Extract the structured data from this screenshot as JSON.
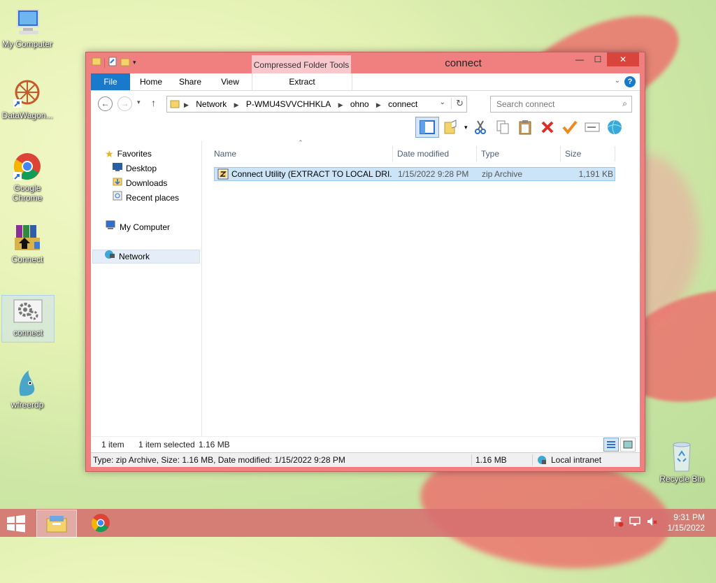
{
  "desktop": {
    "icons": [
      {
        "label": "My Computer"
      },
      {
        "label": "DataWagon..."
      },
      {
        "label": "Google Chrome"
      },
      {
        "label": "Connect"
      },
      {
        "label": "connect"
      },
      {
        "label": "wfreerdp"
      }
    ],
    "recycle_bin": "Recycle Bin"
  },
  "window": {
    "title": "connect",
    "context_tab": "Compressed Folder Tools",
    "ribbon_tabs": [
      "File",
      "Home",
      "Share",
      "View",
      "Extract"
    ],
    "breadcrumb": [
      "Network",
      "P-WMU4SVVCHHKLA",
      "ohno",
      "connect"
    ],
    "search_placeholder": "Search connect",
    "nav": {
      "favorites": "Favorites",
      "desktop": "Desktop",
      "downloads": "Downloads",
      "recent": "Recent places",
      "my_computer": "My Computer",
      "network": "Network"
    },
    "columns": [
      "Name",
      "Date modified",
      "Type",
      "Size"
    ],
    "files": [
      {
        "name": "Connect Utility (EXTRACT TO LOCAL DRI...",
        "date": "1/15/2022 9:28 PM",
        "type": "zip Archive",
        "size": "1,191 KB"
      }
    ],
    "details": {
      "count": "1 item",
      "selected": "1 item selected",
      "size": "1.16 MB"
    },
    "status": {
      "info": "Type: zip Archive, Size: 1.16 MB, Date modified: 1/15/2022 9:28 PM",
      "size": "1.16 MB",
      "zone": "Local intranet"
    }
  },
  "taskbar": {
    "time": "9:31 PM",
    "date": "1/15/2022"
  }
}
